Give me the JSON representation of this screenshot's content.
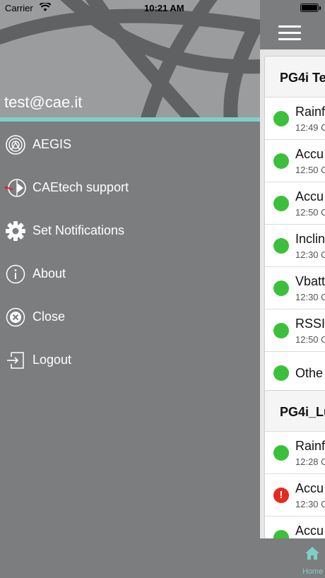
{
  "status_bar": {
    "carrier": "Carrier",
    "time": "10:21 AM"
  },
  "drawer": {
    "user_email": "test@cae.it",
    "menu": [
      {
        "label": "AEGIS",
        "icon": "aegis-logo-icon"
      },
      {
        "label": "CAEtech support",
        "icon": "caetech-support-icon"
      },
      {
        "label": "Set Notifications",
        "icon": "gear-icon"
      },
      {
        "label": "About",
        "icon": "info-icon"
      },
      {
        "label": "Close",
        "icon": "close-icon"
      },
      {
        "label": "Logout",
        "icon": "logout-icon"
      }
    ]
  },
  "main": {
    "cards": [
      {
        "title": "PG4i Te",
        "rows": [
          {
            "title": "Rainf",
            "time": "12:49 C",
            "status": "ok"
          },
          {
            "title": "Accu",
            "time": "12:50 C",
            "status": "ok"
          },
          {
            "title": "Accu",
            "time": "12:50 C",
            "status": "ok"
          },
          {
            "title": "Inclin",
            "time": "12:30 C",
            "status": "ok"
          },
          {
            "title": "Vbatt",
            "time": "12:30 C",
            "status": "ok"
          },
          {
            "title": "RSSI",
            "time": "12:50 C",
            "status": "ok"
          },
          {
            "title": "Othe",
            "time": "",
            "status": "ok"
          }
        ]
      },
      {
        "title": "PG4i_Lu",
        "rows": [
          {
            "title": "Rainf",
            "time": "12:28 C",
            "status": "ok"
          },
          {
            "title": "Accu",
            "time": "12:30 C",
            "status": "alert"
          },
          {
            "title": "Accu",
            "time": "",
            "status": "ok"
          }
        ]
      }
    ],
    "tabbar": {
      "home_label": "Home"
    }
  },
  "colors": {
    "drawer_bg": "#7b7d7f",
    "accent_teal": "#7fcfc6",
    "status_ok": "#3cc03c",
    "status_alert": "#e32b1e"
  }
}
